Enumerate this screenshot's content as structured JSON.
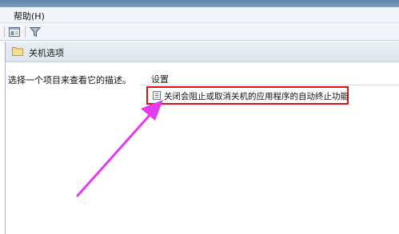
{
  "menubar": {
    "help_label": "帮助(H)"
  },
  "toolbar": {
    "icons": [
      "properties-view-icon",
      "filter-icon"
    ]
  },
  "content": {
    "folder_title": "关机选项",
    "description_prompt": "选择一个项目来查看它的描述。",
    "columns": {
      "settings_header": "设置"
    },
    "settings": [
      {
        "label": "关闭会阻止或取消关机的应用程序的自动终止功能"
      }
    ]
  },
  "colors": {
    "highlight_border": "#e01111",
    "annotation_arrow": "#e23cf0"
  }
}
